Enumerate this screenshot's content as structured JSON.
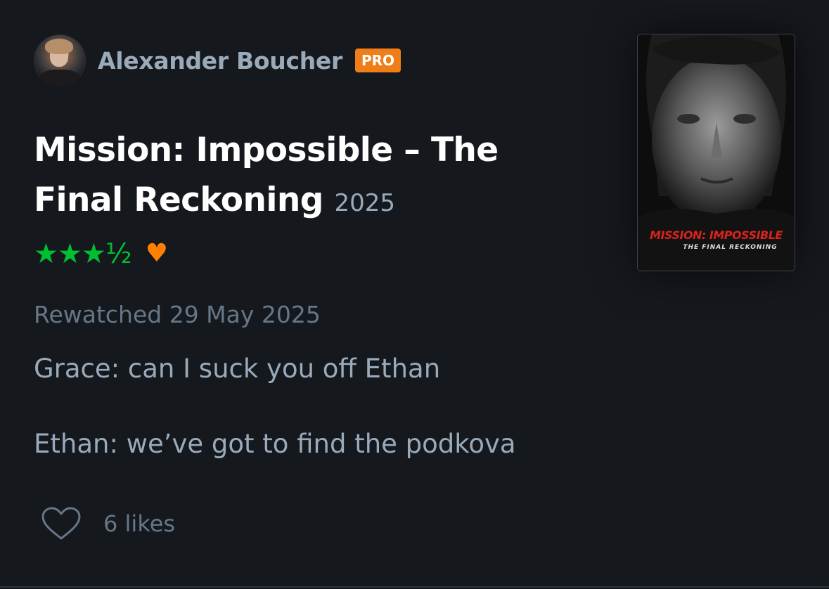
{
  "review": {
    "author": {
      "name": "Alexander Boucher",
      "badge": "PRO"
    },
    "film": {
      "title": "Mission: Impossible – The Final Reckoning",
      "year": "2025"
    },
    "rating": {
      "stars_text": "★★★½",
      "value": 3.5,
      "max": 5,
      "liked": true
    },
    "watched_text": "Rewatched 29 May 2025",
    "body": [
      "Grace: can I suck you off Ethan",
      "Ethan: we’ve got to find the podkova"
    ],
    "likes": {
      "count_text": "6 likes"
    },
    "poster": {
      "title": "MISSION: IMPOSSIBLE",
      "subtitle": "THE FINAL RECKONING"
    }
  },
  "colors": {
    "background": "#15181d",
    "star_green": "#00c030",
    "heart_orange": "#ff8000",
    "pro_badge": "#ef7d18",
    "title_white": "#ffffff",
    "muted_text": "#99aabb",
    "dim_text": "#667788"
  },
  "icons": {
    "rating_heart": "♥",
    "like_heart": "heart-outline-icon"
  }
}
